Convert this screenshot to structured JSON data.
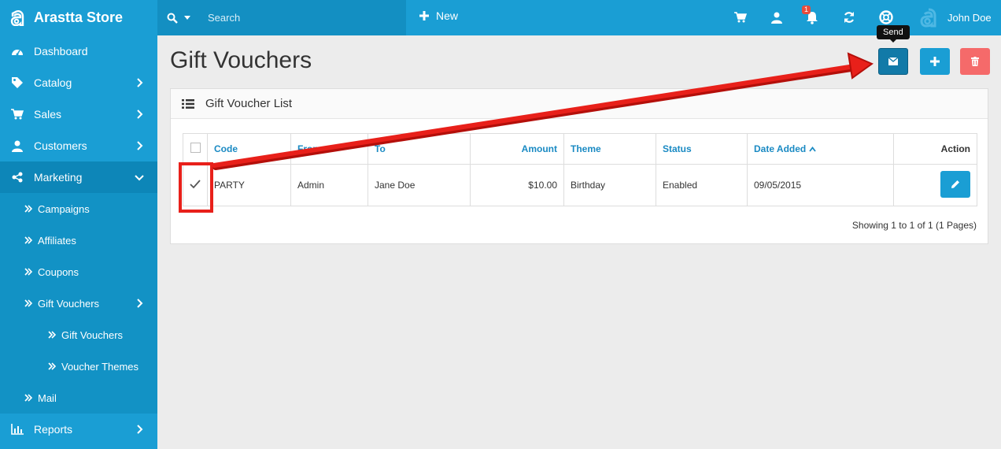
{
  "brand": {
    "name": "Arastta Store"
  },
  "sidebar": {
    "items": [
      {
        "label": "Dashboard"
      },
      {
        "label": "Catalog"
      },
      {
        "label": "Sales"
      },
      {
        "label": "Customers"
      },
      {
        "label": "Marketing"
      },
      {
        "label": "Reports"
      }
    ],
    "marketing_sub": [
      {
        "label": "Campaigns"
      },
      {
        "label": "Affiliates"
      },
      {
        "label": "Coupons"
      },
      {
        "label": "Gift Vouchers"
      },
      {
        "label": "Mail"
      }
    ],
    "gift_vouchers_sub": [
      {
        "label": "Gift Vouchers"
      },
      {
        "label": "Voucher Themes"
      }
    ]
  },
  "header": {
    "search_placeholder": "Search",
    "new_label": "New",
    "notification_count": "1",
    "user_name": "John Doe"
  },
  "page": {
    "title": "Gift Vouchers",
    "send_tooltip": "Send"
  },
  "panel": {
    "title": "Gift Voucher List",
    "columns": {
      "code": "Code",
      "from": "From",
      "to": "To",
      "amount": "Amount",
      "theme": "Theme",
      "status": "Status",
      "date_added": "Date Added",
      "action": "Action"
    },
    "rows": [
      {
        "code": "PARTY",
        "from": "Admin",
        "to": "Jane Doe",
        "amount": "$10.00",
        "theme": "Birthday",
        "status": "Enabled",
        "date_added": "09/05/2015",
        "checked": true
      }
    ],
    "showing": "Showing 1 to 1 of 1 (1 Pages)"
  },
  "colors": {
    "sidebar": "#1a9ed4",
    "sidebar_active": "#0d86b8",
    "link": "#1a8ac3",
    "danger": "#f56a6a",
    "annotation": "#e8201a"
  }
}
